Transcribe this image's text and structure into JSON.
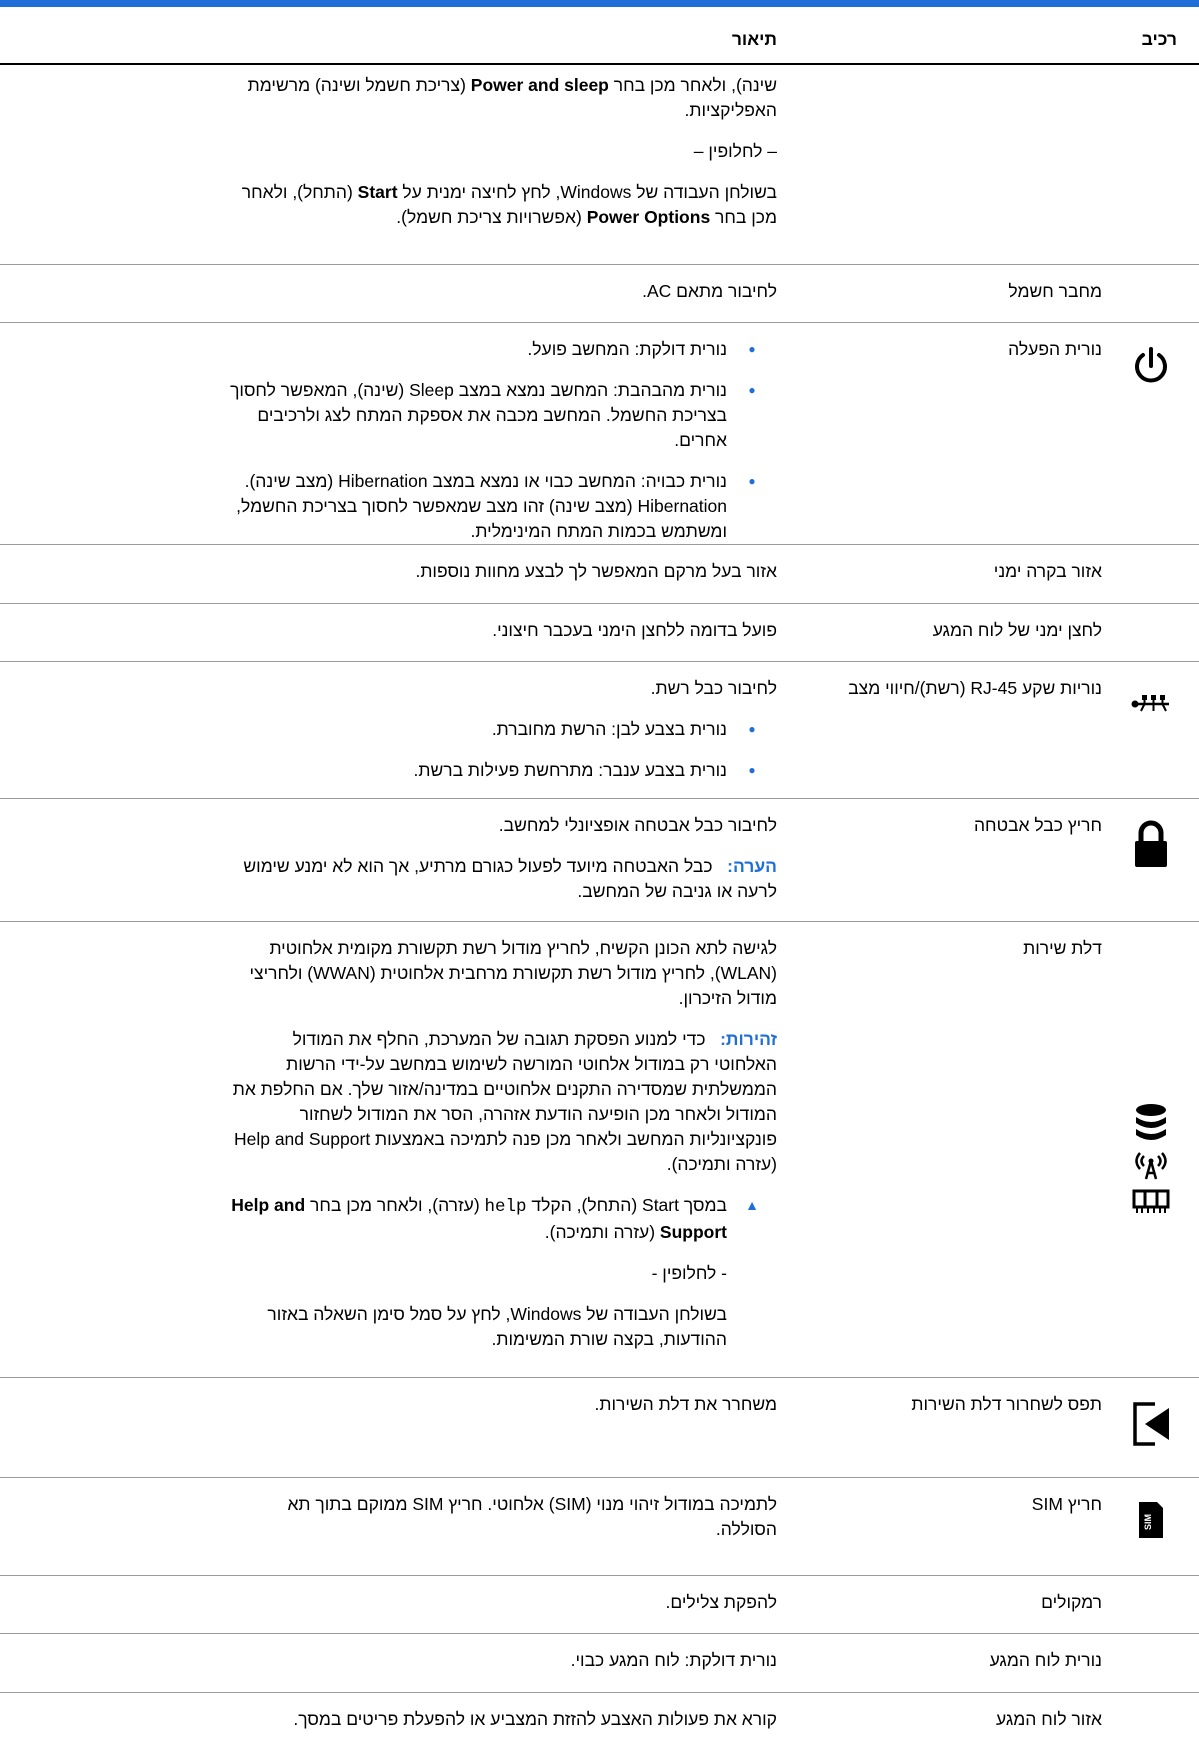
{
  "header": {
    "component": "רכיב",
    "description": "תיאור"
  },
  "continuation": {
    "p1_a": "שינה), ולאחר מכן בחר ",
    "p1_b": "Power and sleep",
    "p1_c": " (צריכת חשמל ושינה) מרשימת האפליקציות.",
    "sep": "– לחלופין –",
    "p2_a": "בשולחן העבודה של Windows, לחץ לחיצה ימנית על ",
    "p2_b": "Start",
    "p2_c": " (התחל), ולאחר מכן בחר ",
    "p2_d": "Power Options",
    "p2_e": " (אפשרויות צריכת חשמל)."
  },
  "rows": {
    "power_connector": {
      "name": "מחבר חשמל",
      "desc": "לחיבור מתאם AC."
    },
    "power_light": {
      "name": "נורית הפעלה",
      "bullets": [
        "נורית דולקת: המחשב פועל.",
        "נורית מהבהבת: המחשב נמצא במצב Sleep (שינה), המאפשר לחסוך בצריכת החשמל. המחשב מכבה את אספקת המתח לצג ולרכיבים אחרים.",
        "נורית כבויה: המחשב כבוי או נמצא במצב Hibernation (מצב שינה). Hibernation (מצב שינה) זהו מצב שמאפשר לחסוך בצריכת החשמל, ומשתמש בכמות המתח המינימלית."
      ]
    },
    "right_control_zone": {
      "name": "אזור בקרה ימני",
      "desc": "אזור בעל מרקם המאפשר לך לבצע מחוות נוספות."
    },
    "right_touchpad_button": {
      "name": "לחצן ימני של לוח המגע",
      "desc": "פועל בדומה ללחצן הימני בעכבר חיצוני."
    },
    "rj45": {
      "name": "נוריות שקע RJ-45 (רשת)/חיווי מצב",
      "desc": "לחיבור כבל רשת.",
      "bullets": [
        "נורית בצבע לבן: הרשת מחוברת.",
        "נורית בצבע ענבר: מתרחשת פעילות ברשת."
      ]
    },
    "security_slot": {
      "name": "חריץ כבל אבטחה",
      "desc": "לחיבור כבל אבטחה אופציונלי למחשב.",
      "note_label": "הערה:",
      "note_text": "כבל האבטחה מיועד לפעול כגורם מרתיע, אך הוא לא ימנע שימוש לרעה או גניבה של המחשב."
    },
    "service_door": {
      "name": "דלת שירות",
      "desc": "לגישה לתא הכונן הקשיח, לחריץ מודול רשת תקשורת מקומית אלחוטית (WLAN), לחריץ מודול רשת תקשורת מרחבית אלחוטית (WWAN) ולחריצי מודול הזיכרון.",
      "caution_label": "זהירות:",
      "caution_text": "כדי למנוע הפסקת תגובה של המערכת, החלף את המודול האלחוטי רק במודול אלחוטי המורשה לשימוש במחשב על-ידי הרשות הממשלתית שמסדירה התקנים אלחוטיים במדינה/אזור שלך. אם החלפת את המודול ולאחר מכן הופיעה הודעת אזהרה, הסר את המודול לשחזור פונקציונליות המחשב ולאחר מכן פנה לתמיכה באמצעות Help and Support (עזרה ותמיכה).",
      "step_a": "במסך Start (התחל), הקלד ",
      "step_code": "help",
      "step_b": " (עזרה), ולאחר מכן בחר ",
      "step_c": "Help and Support",
      "step_d": " (עזרה ותמיכה).",
      "sep": "- לחלופין -",
      "alt": "בשולחן העבודה של Windows, לחץ על סמל סימן השאלה באזור ההודעות, בקצה שורת המשימות."
    },
    "service_door_latch": {
      "name": "תפס לשחרור דלת השירות",
      "desc": "משחרר את דלת השירות."
    },
    "sim_slot": {
      "name": "חריץ SIM",
      "desc": "לתמיכה במודול זיהוי מנוי (SIM) אלחוטי. חריץ SIM ממוקם בתוך תא הסוללה.",
      "icon_text": "SIM"
    },
    "speakers": {
      "name": "רמקולים",
      "desc": "להפקת צלילים."
    },
    "touchpad_light": {
      "name": "נורית לוח המגע",
      "desc": "נורית דולקת: לוח המגע כבוי."
    },
    "touchpad_zone": {
      "name": "אזור לוח המגע",
      "desc": "קורא את פעולות האצבע להזזת המצביע או להפעלת פריטים במסך."
    }
  }
}
